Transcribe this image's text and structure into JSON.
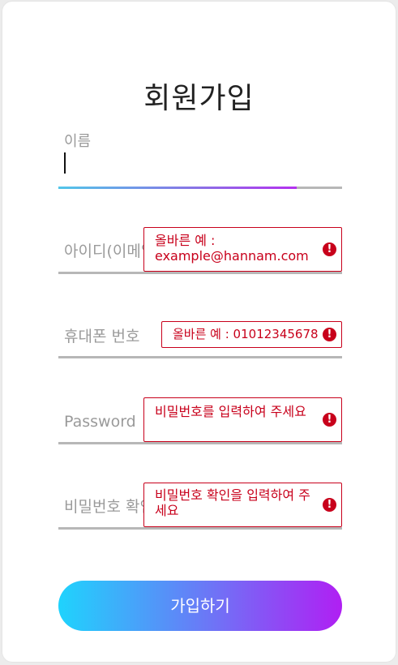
{
  "form": {
    "title": "회원가입",
    "name_field": {
      "label": "이름",
      "value": ""
    },
    "id_field": {
      "placeholder": "아이디(이메일)",
      "error": "올바른 예 : example@hannam.com"
    },
    "phone_field": {
      "placeholder": "휴대폰 번호",
      "error": "올바른 예 : 01012345678"
    },
    "password_field": {
      "placeholder": "Password",
      "error": "비밀번호를 입력하여 주세요"
    },
    "password_confirm_field": {
      "placeholder": "비밀번호 확인",
      "error": "비밀번호 확인을 입력하여 주세요"
    },
    "submit_label": "가입하기"
  },
  "icons": {
    "error": "exclamation-circle-icon"
  },
  "colors": {
    "error": "#c8001b",
    "gradient_start": "#1fd3fd",
    "gradient_end": "#b01ff3",
    "underline": "#b7b7b7"
  }
}
